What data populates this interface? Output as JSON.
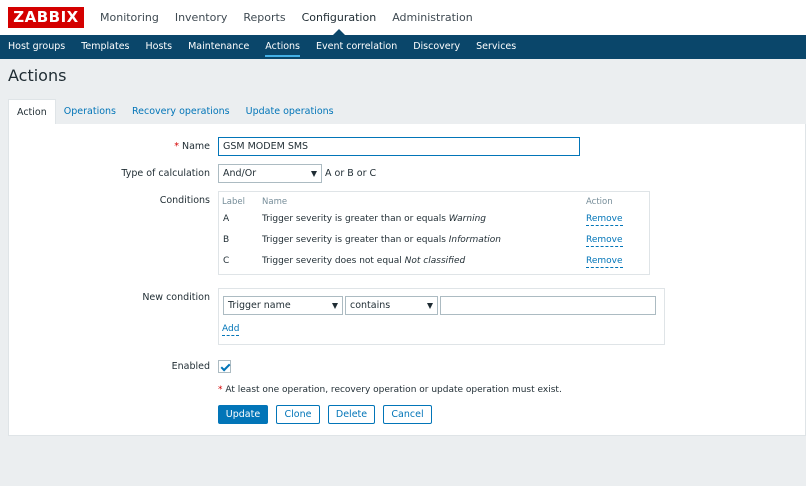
{
  "app": {
    "logo": "ZABBIX"
  },
  "main_nav": [
    "Monitoring",
    "Inventory",
    "Reports",
    "Configuration",
    "Administration"
  ],
  "sub_nav": [
    "Host groups",
    "Templates",
    "Hosts",
    "Maintenance",
    "Actions",
    "Event correlation",
    "Discovery",
    "Services"
  ],
  "page": {
    "title": "Actions"
  },
  "tabs": [
    "Action",
    "Operations",
    "Recovery operations",
    "Update operations"
  ],
  "form": {
    "name_label": "Name",
    "required_mark": "*",
    "name_value": "GSM MODEM SMS",
    "calc_label": "Type of calculation",
    "calc_value": "And/Or",
    "calc_formula": "A or B or C",
    "conditions_label": "Conditions",
    "conditions_headers": {
      "label": "Label",
      "name": "Name",
      "action": "Action"
    },
    "conditions": [
      {
        "label": "A",
        "text": "Trigger severity is greater than or equals ",
        "value": "Warning",
        "action": "Remove"
      },
      {
        "label": "B",
        "text": "Trigger severity is greater than or equals ",
        "value": "Information",
        "action": "Remove"
      },
      {
        "label": "C",
        "text": "Trigger severity does not equal ",
        "value": "Not classified",
        "action": "Remove"
      }
    ],
    "new_condition_label": "New condition",
    "new_condition_type": "Trigger name",
    "new_condition_operator": "contains",
    "new_condition_value": "",
    "add_link": "Add",
    "enabled_label": "Enabled",
    "note_text": "At least one operation, recovery operation or update operation must exist."
  },
  "buttons": {
    "update": "Update",
    "clone": "Clone",
    "delete": "Delete",
    "cancel": "Cancel"
  },
  "colors": {
    "brand": "#d40000",
    "nav_bg": "#0a466a",
    "link": "#0275b8"
  }
}
